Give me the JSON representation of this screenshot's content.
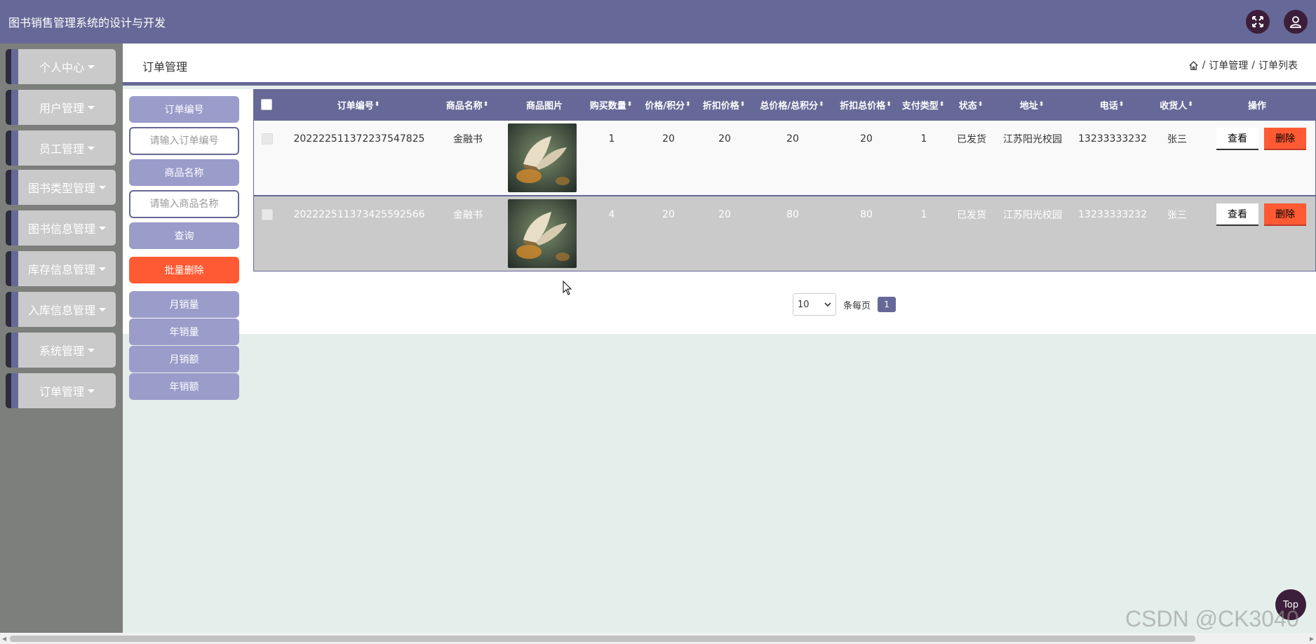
{
  "header": {
    "title": "图书销售管理系统的设计与开发"
  },
  "sidebar": {
    "items": [
      {
        "label": "个人中心"
      },
      {
        "label": "用户管理"
      },
      {
        "label": "员工管理"
      },
      {
        "label": "图书类型管理"
      },
      {
        "label": "图书信息管理"
      },
      {
        "label": "库存信息管理"
      },
      {
        "label": "入库信息管理"
      },
      {
        "label": "系统管理"
      },
      {
        "label": "订单管理"
      }
    ]
  },
  "page": {
    "title": "订单管理",
    "breadcrumb": [
      "订单管理",
      "订单列表"
    ],
    "breadcrumb_sep": "/"
  },
  "search": {
    "order_no_label": "订单编号",
    "order_no_placeholder": "请输入订单编号",
    "product_label": "商品名称",
    "product_placeholder": "请输入商品名称",
    "query_label": "查询",
    "batch_delete_label": "批量删除",
    "monthly_sales_label": "月销量",
    "yearly_sales_label": "年销量",
    "monthly_revenue_label": "月销额",
    "yearly_revenue_label": "年销额"
  },
  "table": {
    "columns": [
      "订单编号",
      "商品名称",
      "商品图片",
      "购买数量",
      "价格/积分",
      "折扣价格",
      "总价格/总积分",
      "折扣总价格",
      "支付类型",
      "状态",
      "地址",
      "电话",
      "收货人",
      "操作"
    ],
    "sort_glyph": "⬍",
    "rows": [
      {
        "order_no": "202222511372237547825",
        "product": "金融书",
        "qty": "1",
        "price": "20",
        "discount_price": "20",
        "total": "20",
        "discount_total": "20",
        "pay_type": "1",
        "status": "已发货",
        "address": "江苏阳光校园",
        "phone": "13233333232",
        "receiver": "张三"
      },
      {
        "order_no": "202222511373425592566",
        "product": "金融书",
        "qty": "4",
        "price": "20",
        "discount_price": "20",
        "total": "80",
        "discount_total": "80",
        "pay_type": "1",
        "status": "已发货",
        "address": "江苏阳光校园",
        "phone": "13233333232",
        "receiver": "张三"
      }
    ],
    "view_label": "查看",
    "delete_label": "删除"
  },
  "pagination": {
    "page_size": "10",
    "per_page_label": "条每页",
    "current_page": "1"
  },
  "footer": {
    "top_label": "Top",
    "watermark": "CSDN @CK3040"
  },
  "colors": {
    "primary": "#666997",
    "danger": "#ff5a33",
    "sidebar_bg": "#7d7f7c",
    "content_bg": "#e4efeb"
  },
  "icons": {
    "fullscreen": "fullscreen-icon",
    "user": "user-icon",
    "home": "home-icon"
  }
}
